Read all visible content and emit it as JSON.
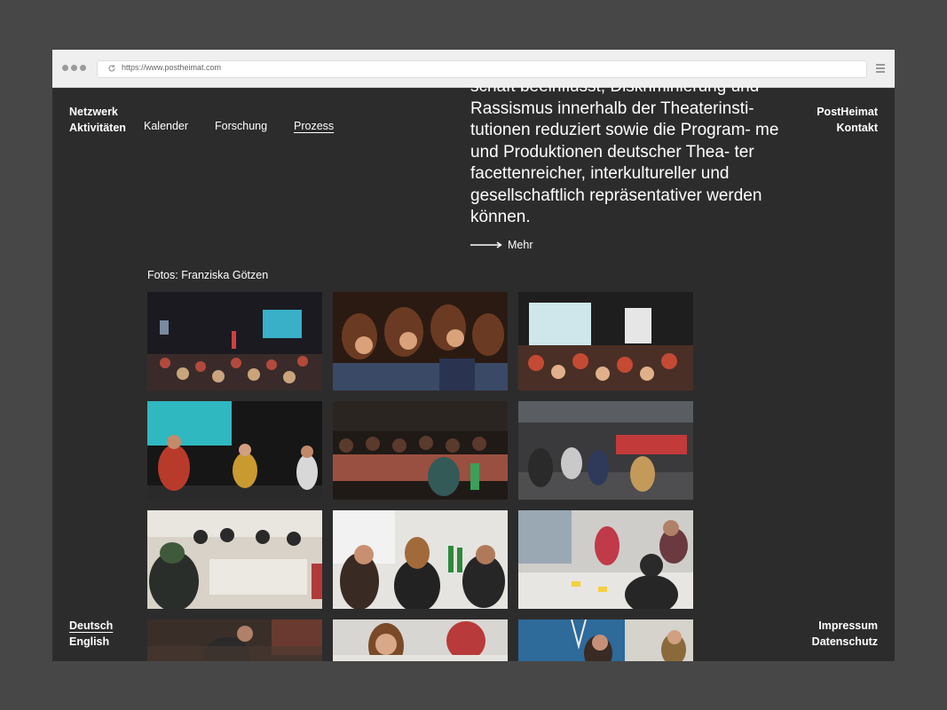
{
  "browser": {
    "url": "https://www.postheimat.com"
  },
  "nav": {
    "left_primary": [
      "Netzwerk",
      "Aktivitäten"
    ],
    "sub_items": [
      "Kalender",
      "Forschung",
      "Prozess"
    ],
    "active_sub": "Prozess",
    "right_items": [
      "PostHeimat",
      "Kontakt"
    ]
  },
  "intro": {
    "text": "schaft beeinflusst, Diskriminierung und Rassismus innerhalb der Theaterinsti- tutionen reduziert sowie die Program- me und Produktionen deutscher Thea- ter facettenreicher, interkultureller und gesellschaftlich repräsentativer werden können.",
    "more_label": "Mehr"
  },
  "gallery": {
    "credit": "Fotos: Franziska Götzen",
    "photos": [
      {
        "name": "photo-audience-stage-1"
      },
      {
        "name": "photo-audience-closeup-1"
      },
      {
        "name": "photo-audience-presentation"
      },
      {
        "name": "photo-panel-stage"
      },
      {
        "name": "photo-audience-seated"
      },
      {
        "name": "photo-group-discussion-hall"
      },
      {
        "name": "photo-workshop-table-1"
      },
      {
        "name": "photo-workshop-table-2"
      },
      {
        "name": "photo-workshop-table-3"
      },
      {
        "name": "photo-workshop-4"
      },
      {
        "name": "photo-workshop-5"
      },
      {
        "name": "photo-workshop-6"
      }
    ]
  },
  "footer": {
    "languages": [
      "Deutsch",
      "English"
    ],
    "active_language": "Deutsch",
    "links": [
      "Impressum",
      "Datenschutz"
    ]
  },
  "colors": {
    "page_bg": "#2d2c2c",
    "outer_bg": "#474747",
    "text": "#ffffff"
  }
}
